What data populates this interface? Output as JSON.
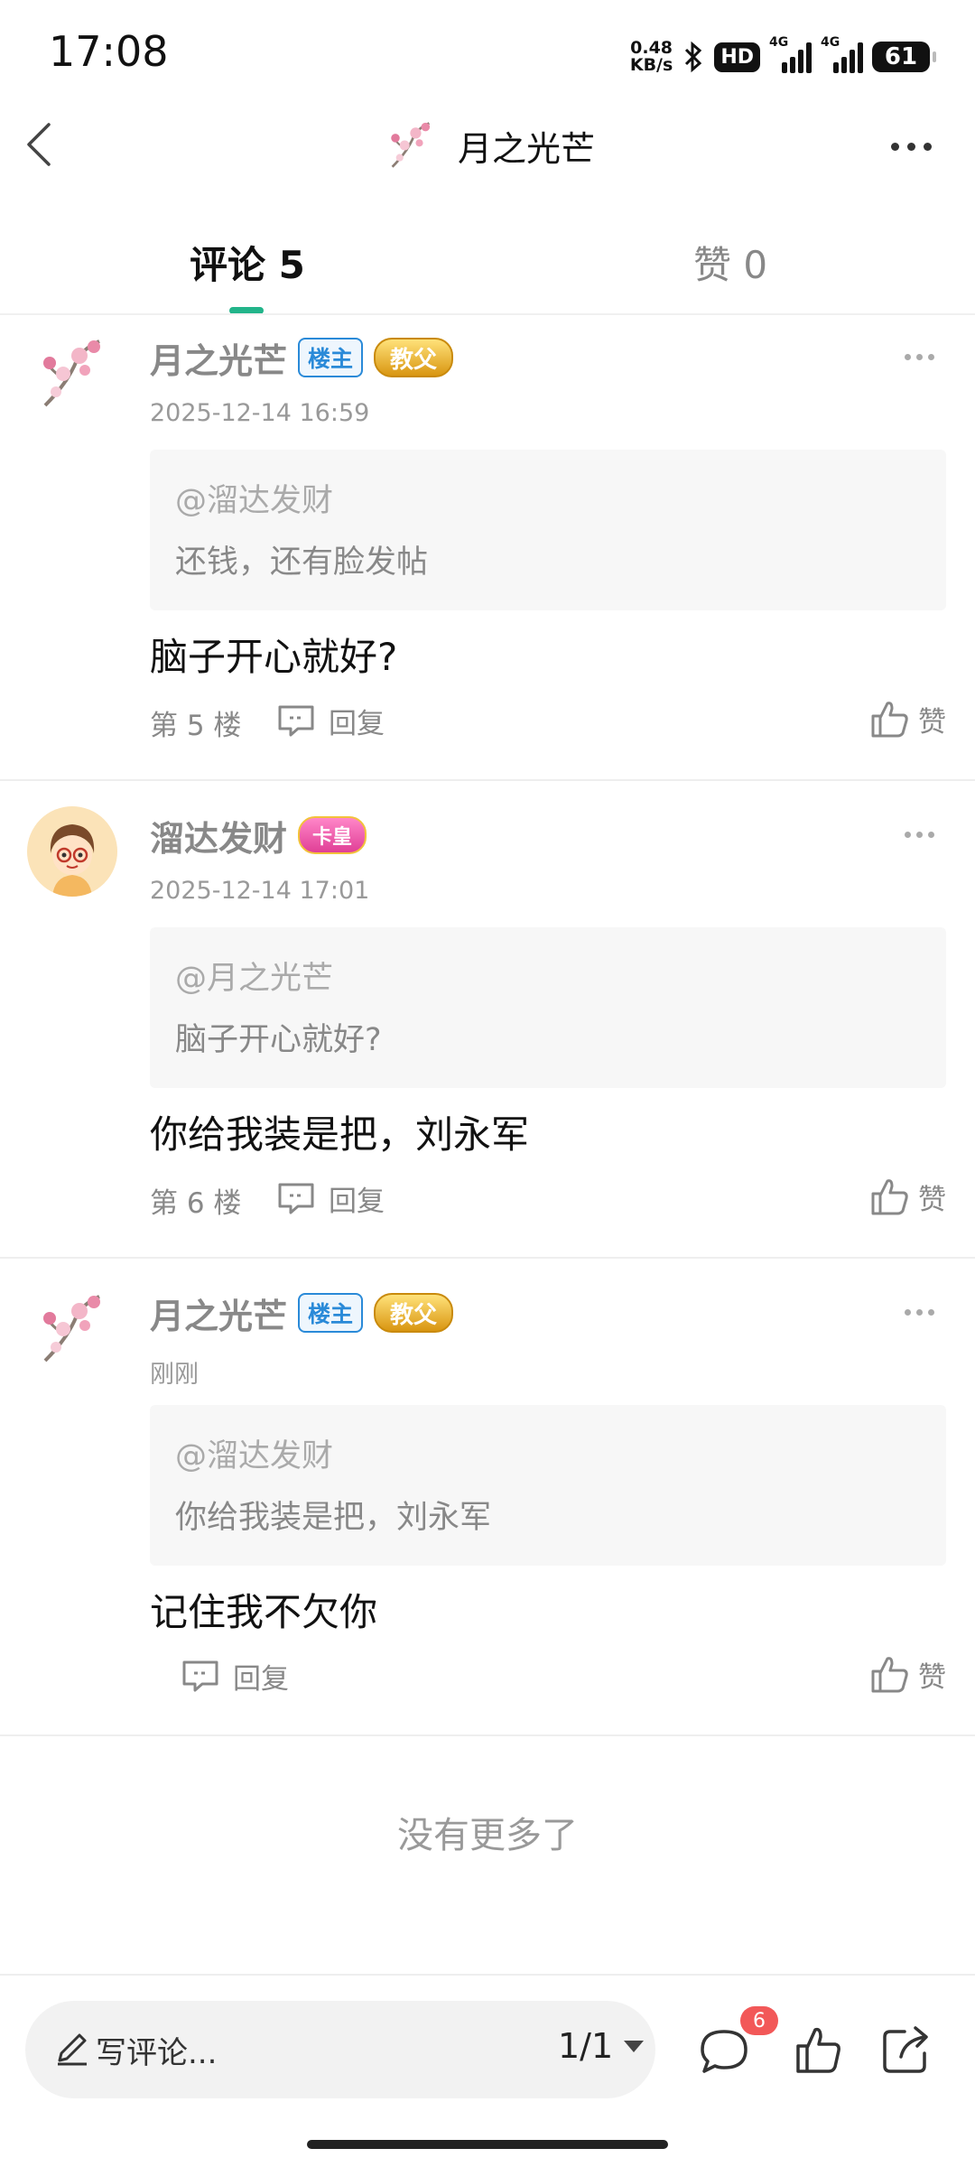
{
  "status_bar": {
    "time": "17:08",
    "net_speed_top": "0.48",
    "net_speed_unit": "KB/s",
    "hd": "HD",
    "sim1": "4G",
    "sim2": "4G",
    "battery": "61"
  },
  "header": {
    "title": "月之光芒"
  },
  "tabs": {
    "comments_label": "评论 5",
    "likes_label": "赞 0",
    "active": "comments"
  },
  "comments": [
    {
      "author": "月之光芒",
      "op_badge": "楼主",
      "title_badge": "教父",
      "time": "2025-12-14 16:59",
      "quote_mention": "@溜达发财",
      "quote_text": "还钱，还有脸发帖",
      "text": "脑子开心就好?",
      "floor": "第 5 楼",
      "reply_label": "回复",
      "like_label": "赞"
    },
    {
      "author": "溜达发财",
      "title_badge": "卡皇",
      "time": "2025-12-14 17:01",
      "quote_mention": "@月之光芒",
      "quote_text": "脑子开心就好?",
      "text": "你给我装是把，刘永军",
      "floor": "第 6 楼",
      "reply_label": "回复",
      "like_label": "赞"
    },
    {
      "author": "月之光芒",
      "op_badge": "楼主",
      "title_badge": "教父",
      "time": "刚刚",
      "quote_mention": "@溜达发财",
      "quote_text": "你给我装是把，刘永军",
      "text": "记住我不欠你",
      "floor": "",
      "reply_label": "回复",
      "like_label": "赞"
    }
  ],
  "end_note": "没有更多了",
  "bottom_bar": {
    "composer_placeholder": "写评论...",
    "page_indicator": "1/1",
    "comment_count_badge": "6"
  },
  "colors": {
    "accent": "#22b48a",
    "op_badge": "#2a8ad8",
    "notification": "#f25858"
  },
  "icons": [
    "back-icon",
    "more-icon",
    "reply-icon",
    "thumbs-up-icon",
    "pen-icon",
    "comment-icon",
    "share-icon"
  ]
}
